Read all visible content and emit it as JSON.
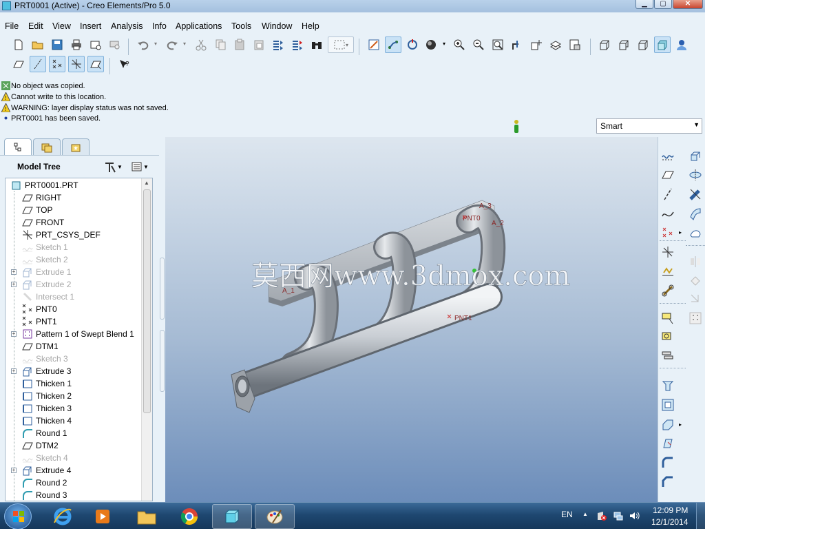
{
  "window": {
    "title": "PRT0001 (Active) - Creo Elements/Pro 5.0"
  },
  "menu": [
    "File",
    "Edit",
    "View",
    "Insert",
    "Analysis",
    "Info",
    "Applications",
    "Tools",
    "Window",
    "Help"
  ],
  "messages": [
    {
      "icon": "info-icon",
      "text": "No object was copied."
    },
    {
      "icon": "warning-icon",
      "text": "Cannot write to this location."
    },
    {
      "icon": "warning-icon",
      "text": "WARNING: layer display status was not saved."
    },
    {
      "icon": "bullet-icon",
      "text": "PRT0001 has been saved."
    }
  ],
  "filter": {
    "value": "Smart"
  },
  "model_tree": {
    "title": "Model Tree",
    "items": [
      {
        "label": "PRT0001.PRT",
        "icon": "part-icon",
        "dim": false,
        "expand": false
      },
      {
        "label": "RIGHT",
        "icon": "datum-plane-icon",
        "dim": false,
        "expand": false
      },
      {
        "label": "TOP",
        "icon": "datum-plane-icon",
        "dim": false,
        "expand": false
      },
      {
        "label": "FRONT",
        "icon": "datum-plane-icon",
        "dim": false,
        "expand": false
      },
      {
        "label": "PRT_CSYS_DEF",
        "icon": "csys-icon",
        "dim": false,
        "expand": false
      },
      {
        "label": "Sketch 1",
        "icon": "sketch-icon",
        "dim": true,
        "expand": false
      },
      {
        "label": "Sketch 2",
        "icon": "sketch-icon",
        "dim": true,
        "expand": false
      },
      {
        "label": "Extrude 1",
        "icon": "extrude-icon",
        "dim": true,
        "expand": true
      },
      {
        "label": "Extrude 2",
        "icon": "extrude-icon",
        "dim": true,
        "expand": true
      },
      {
        "label": "Intersect 1",
        "icon": "intersect-icon",
        "dim": true,
        "expand": false
      },
      {
        "label": "PNT0",
        "icon": "datum-point-icon",
        "dim": false,
        "expand": false
      },
      {
        "label": "PNT1",
        "icon": "datum-point-icon",
        "dim": false,
        "expand": false
      },
      {
        "label": "Pattern 1 of Swept Blend 1",
        "icon": "pattern-icon",
        "dim": false,
        "expand": true
      },
      {
        "label": "DTM1",
        "icon": "datum-plane-icon",
        "dim": false,
        "expand": false
      },
      {
        "label": "Sketch 3",
        "icon": "sketch-icon",
        "dim": true,
        "expand": false
      },
      {
        "label": "Extrude 3",
        "icon": "extrude-icon",
        "dim": false,
        "expand": true
      },
      {
        "label": "Thicken 1",
        "icon": "thicken-icon",
        "dim": false,
        "expand": false
      },
      {
        "label": "Thicken 2",
        "icon": "thicken-icon",
        "dim": false,
        "expand": false
      },
      {
        "label": "Thicken 3",
        "icon": "thicken-icon",
        "dim": false,
        "expand": false
      },
      {
        "label": "Thicken 4",
        "icon": "thicken-icon",
        "dim": false,
        "expand": false
      },
      {
        "label": "Round 1",
        "icon": "round-icon",
        "dim": false,
        "expand": false
      },
      {
        "label": "DTM2",
        "icon": "datum-plane-icon",
        "dim": false,
        "expand": false
      },
      {
        "label": "Sketch 4",
        "icon": "sketch-icon",
        "dim": true,
        "expand": false
      },
      {
        "label": "Extrude 4",
        "icon": "extrude-icon",
        "dim": false,
        "expand": true
      },
      {
        "label": "Round 2",
        "icon": "round-icon",
        "dim": false,
        "expand": false
      },
      {
        "label": "Round 3",
        "icon": "round-icon",
        "dim": false,
        "expand": false
      }
    ]
  },
  "viewport": {
    "labels": [
      "A_3",
      "PNT0",
      "A_2",
      "A_1",
      "PNT1"
    ],
    "watermark": "莫西网www.3dmox.com"
  },
  "taskbar": {
    "language": "EN",
    "time": "12:09 PM",
    "date": "12/1/2014"
  }
}
